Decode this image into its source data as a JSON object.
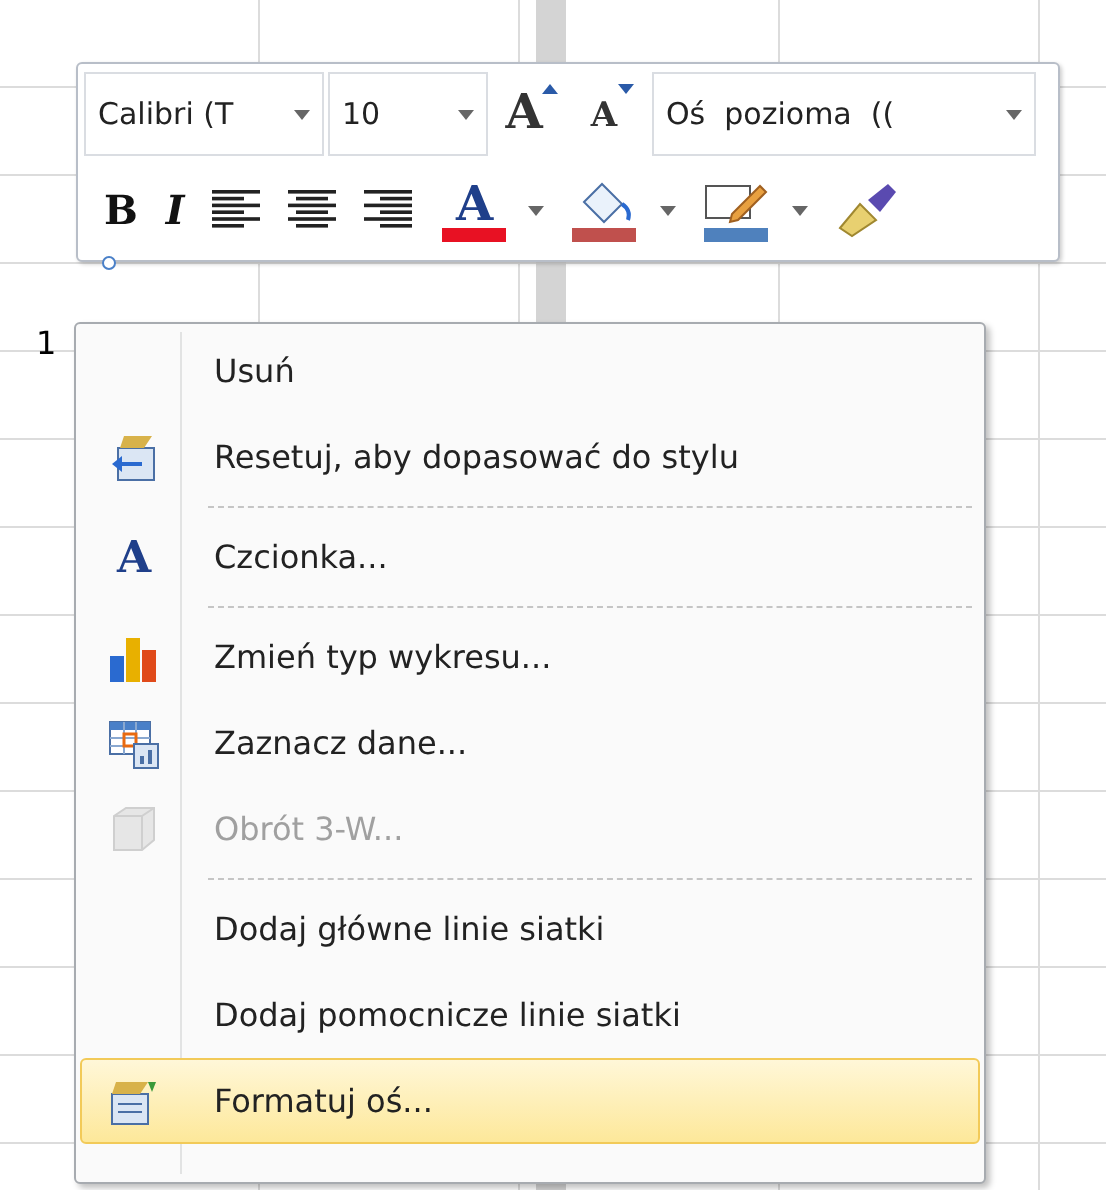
{
  "sheet": {
    "cell_text": "1"
  },
  "mini_toolbar": {
    "font": {
      "value": "Calibri (T"
    },
    "size": {
      "value": "10"
    },
    "grow_font": {
      "glyph": "A"
    },
    "shrink_font": {
      "glyph": "A"
    },
    "element": {
      "value": "Oś  pozioma  (("
    },
    "bold": {
      "glyph": "B"
    },
    "italic": {
      "glyph": "I"
    },
    "font_color": {
      "glyph": "A",
      "color": "#e81123"
    },
    "fill_color": {
      "color": "#c0504d"
    },
    "outline_color": {
      "color": "#4f81bd"
    }
  },
  "context_menu": {
    "items": [
      {
        "kind": "item",
        "label": "Usuń",
        "disabled": false,
        "selected": false
      },
      {
        "kind": "item",
        "label": "Resetuj, aby dopasować do stylu",
        "disabled": false,
        "selected": false
      },
      {
        "kind": "separator"
      },
      {
        "kind": "item",
        "label": "Czcionka...",
        "glyph": "A",
        "disabled": false,
        "selected": false
      },
      {
        "kind": "separator"
      },
      {
        "kind": "item",
        "label": "Zmień typ wykresu...",
        "disabled": false,
        "selected": false
      },
      {
        "kind": "item",
        "label": "Zaznacz dane...",
        "disabled": false,
        "selected": false
      },
      {
        "kind": "item",
        "label": "Obrót 3-W...",
        "disabled": true,
        "selected": false
      },
      {
        "kind": "separator"
      },
      {
        "kind": "item",
        "label": "Dodaj główne linie siatki",
        "disabled": false,
        "selected": false
      },
      {
        "kind": "item",
        "label": "Dodaj pomocnicze linie siatki",
        "disabled": false,
        "selected": false
      },
      {
        "kind": "item",
        "label": "Formatuj oś...",
        "disabled": false,
        "selected": true
      }
    ]
  }
}
